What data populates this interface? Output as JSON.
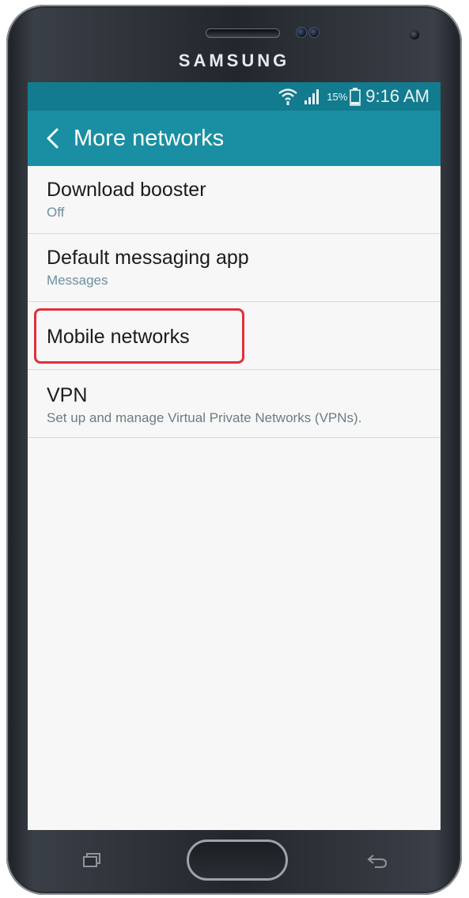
{
  "device": {
    "brand": "SAMSUNG"
  },
  "status_bar": {
    "battery_percent": "15%",
    "time": "9:16 AM",
    "icons": [
      "wifi-icon",
      "signal-icon",
      "battery-icon"
    ]
  },
  "app_bar": {
    "back_icon": "chevron-left-icon",
    "title": "More networks"
  },
  "settings": {
    "items": [
      {
        "title": "Download booster",
        "subtitle": "Off"
      },
      {
        "title": "Default messaging app",
        "subtitle": "Messages"
      },
      {
        "title": "Mobile networks",
        "highlighted": true
      },
      {
        "title": "VPN",
        "subtitle": "Set up and manage Virtual Private Networks (VPNs)."
      }
    ]
  },
  "colors": {
    "status_bar": "#137b8e",
    "app_bar": "#1a8fa3",
    "highlight": "#e0303b",
    "background": "#f7f7f7"
  },
  "hardware_keys": [
    "recent-apps-key",
    "home-button",
    "back-key"
  ]
}
